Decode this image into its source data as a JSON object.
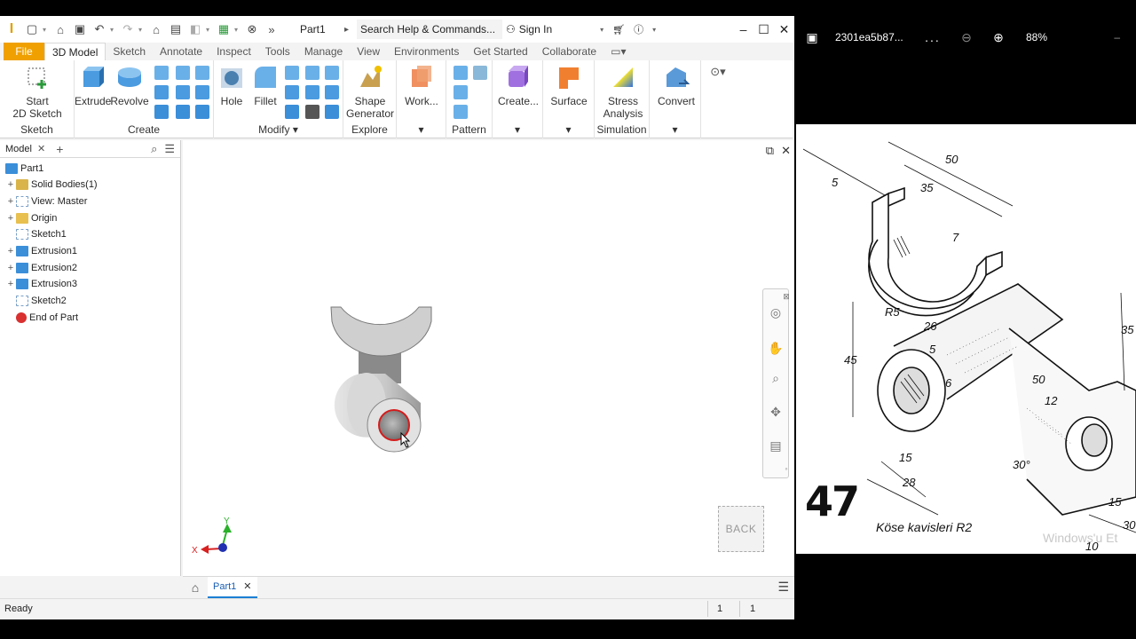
{
  "app": {
    "logo": "I",
    "document_title": "Part1",
    "search_placeholder": "Search Help & Commands...",
    "sign_in": "Sign In"
  },
  "menu": {
    "tabs": [
      "File",
      "3D Model",
      "Sketch",
      "Annotate",
      "Inspect",
      "Tools",
      "Manage",
      "View",
      "Environments",
      "Get Started",
      "Collaborate"
    ],
    "active": "3D Model"
  },
  "ribbon": {
    "start_line1": "Start",
    "start_line2": "2D Sketch",
    "extrude": "Extrude",
    "revolve": "Revolve",
    "hole": "Hole",
    "fillet": "Fillet",
    "shape_line1": "Shape",
    "shape_line2": "Generator",
    "work": "Work...",
    "create_btn": "Create...",
    "surface": "Surface",
    "stress_line1": "Stress",
    "stress_line2": "Analysis",
    "convert": "Convert",
    "groups": {
      "sketch": "Sketch",
      "create": "Create",
      "modify": "Modify",
      "explore": "Explore",
      "pattern": "Pattern",
      "simulation": "Simulation"
    },
    "accent": "#f0a000"
  },
  "browser": {
    "title": "Model",
    "items": [
      {
        "label": "Part1",
        "expand": "",
        "color": "#3b8fd9"
      },
      {
        "label": "Solid Bodies(1)",
        "expand": "+",
        "color": "#d9b44a"
      },
      {
        "label": "View: Master",
        "expand": "+",
        "color": "#7aa0c8"
      },
      {
        "label": "Origin",
        "expand": "+",
        "color": "#e8c050"
      },
      {
        "label": "Sketch1",
        "expand": "",
        "color": "#7aa0c8"
      },
      {
        "label": "Extrusion1",
        "expand": "+",
        "color": "#3b8fd9"
      },
      {
        "label": "Extrusion2",
        "expand": "+",
        "color": "#3b8fd9"
      },
      {
        "label": "Extrusion3",
        "expand": "+",
        "color": "#3b8fd9"
      },
      {
        "label": "Sketch2",
        "expand": "",
        "color": "#7aa0c8"
      },
      {
        "label": "End of Part",
        "expand": "",
        "color": "#d93030"
      }
    ]
  },
  "viewport": {
    "viewcube_label": "BACK",
    "axis_x": "X",
    "axis_y": "Y"
  },
  "doc_tab": "Part1",
  "status": {
    "text": "Ready",
    "count1": "1",
    "count2": "1"
  },
  "viewer": {
    "file_name": "2301ea5b87...",
    "more": "...",
    "zoom": "88%",
    "drawing_number": "47",
    "note": "Köse kavisleri R2",
    "watermark": "Windows'u Et",
    "dims": [
      "50",
      "35",
      "5",
      "7",
      "R5",
      "45",
      "26",
      "35",
      "50",
      "12",
      "15",
      "28",
      "30°",
      "15",
      "10",
      "30",
      "6",
      "5"
    ]
  }
}
